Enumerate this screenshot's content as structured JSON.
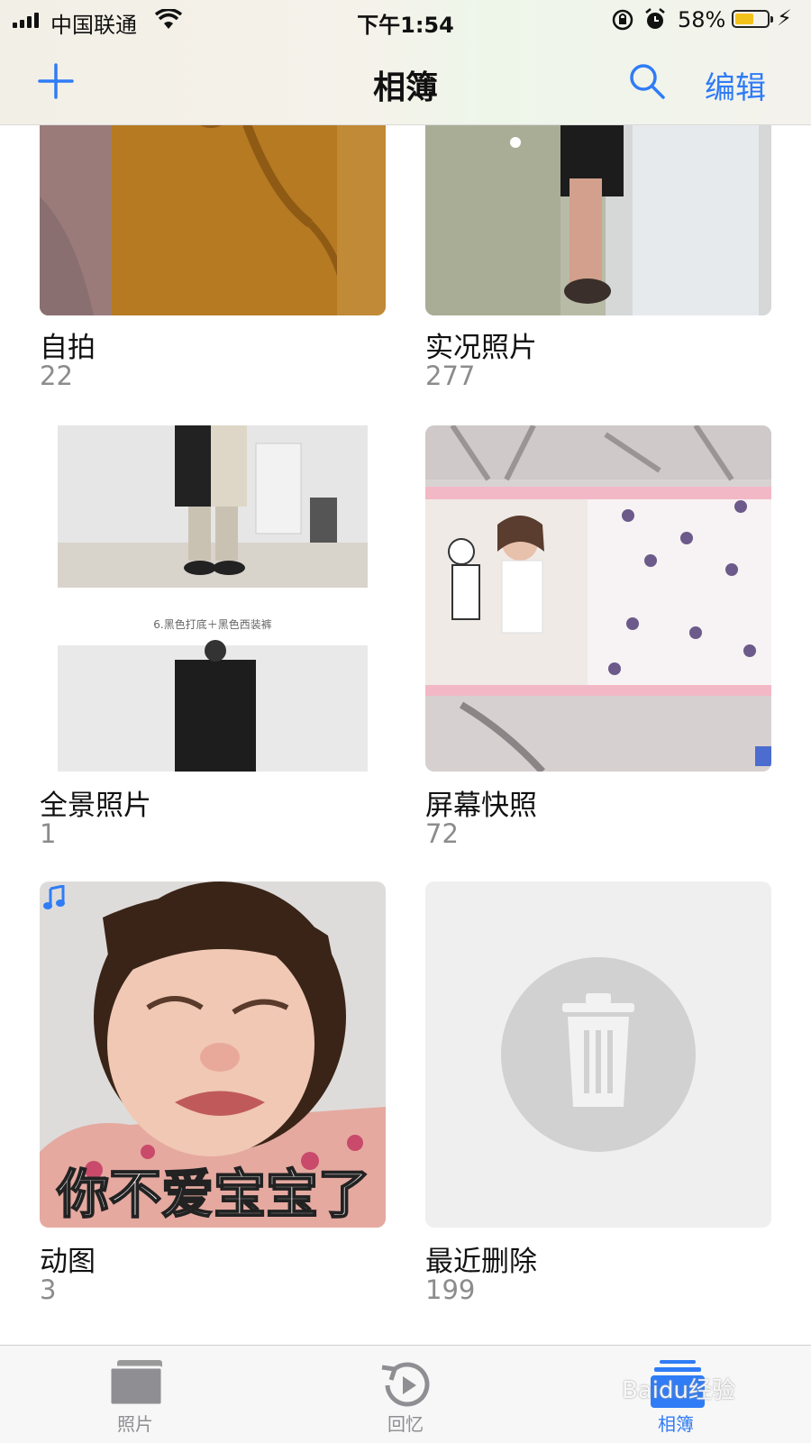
{
  "status_bar": {
    "carrier": "中国联通",
    "time": "下午1:54",
    "battery_percent": "58%",
    "battery_level": 0.58
  },
  "nav": {
    "title": "相簿",
    "edit_label": "编辑",
    "accent_color": "#2f7cf6"
  },
  "albums": [
    {
      "name": "自拍",
      "count": "22",
      "thumb": "photo"
    },
    {
      "name": "实况照片",
      "count": "277",
      "thumb": "photo"
    },
    {
      "name": "全景照片",
      "count": "1",
      "thumb": "photo"
    },
    {
      "name": "屏幕快照",
      "count": "72",
      "thumb": "photo"
    },
    {
      "name": "动图",
      "count": "3",
      "thumb": "photo",
      "thumb_caption": "你不爱宝宝了",
      "badge_icon": "music-note-icon"
    },
    {
      "name": "最近删除",
      "count": "199",
      "thumb": "trash-placeholder"
    }
  ],
  "panorama_thumb_caption": "6.黑色打底＋黑色西装裤",
  "tabs": [
    {
      "label": "照片",
      "icon": "photos-stack-icon",
      "active": false
    },
    {
      "label": "回忆",
      "icon": "memories-icon",
      "active": false
    },
    {
      "label": "相簿",
      "icon": "albums-icon",
      "active": true
    }
  ],
  "watermark": "Baidu经验"
}
